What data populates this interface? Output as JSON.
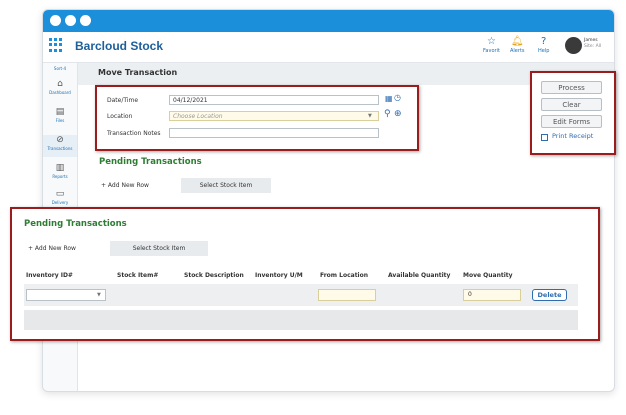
{
  "app": {
    "title": "Barcloud Stock"
  },
  "topnav": {
    "items": [
      {
        "label": "Favorit",
        "icon": "star-icon"
      },
      {
        "label": "Alerts",
        "icon": "bell-icon"
      },
      {
        "label": "Help",
        "icon": "question-icon"
      }
    ],
    "user": {
      "name": "James",
      "role": "Site: All"
    }
  },
  "sidebar": {
    "collapse_label": "Sort-4",
    "items": [
      {
        "label": "Dashboard",
        "icon": "home-icon"
      },
      {
        "label": "Files",
        "icon": "file-icon"
      },
      {
        "label": "Transactions",
        "icon": "transaction-icon"
      },
      {
        "label": "Reports",
        "icon": "chart-icon"
      },
      {
        "label": "Delivery",
        "icon": "delivery-icon"
      }
    ]
  },
  "page": {
    "title": "Move Transaction"
  },
  "form": {
    "date_label": "Date/Time",
    "date_value": "04/12/2021",
    "location_label": "Location",
    "location_placeholder": "Choose Location",
    "notes_label": "Transaction Notes"
  },
  "actions": {
    "process": "Process",
    "clear": "Clear",
    "edit_forms": "Edit Forms",
    "print_receipt": "Print Receipt"
  },
  "pending": {
    "title": "Pending Transactions",
    "add_row": "+ Add New Row",
    "select_stock": "Select Stock Item",
    "columns": [
      "Inventory ID#",
      "Stock Item#",
      "Stock Description",
      "Inventory U/M",
      "From Location",
      "Available Quantity",
      "Move Quantity"
    ],
    "row": {
      "move_quantity": "0"
    },
    "delete": "Delete"
  }
}
